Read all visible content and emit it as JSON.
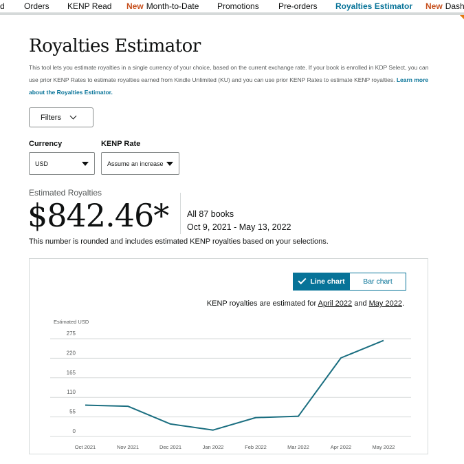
{
  "nav": {
    "items": [
      {
        "label": "d",
        "new": "",
        "x": 0
      },
      {
        "label": "Orders",
        "new": "",
        "x": 35
      },
      {
        "label": "KENP Read",
        "new": "",
        "x": 98
      },
      {
        "label": "Month-to-Date",
        "new": "New",
        "x": 184
      },
      {
        "label": "Promotions",
        "new": "",
        "x": 316
      },
      {
        "label": "Pre-orders",
        "new": "",
        "x": 405
      },
      {
        "label": "Royalties Estimator",
        "new": "",
        "x": 488,
        "active": true
      },
      {
        "label": "Dashb",
        "new": "New",
        "x": 619
      }
    ]
  },
  "page": {
    "title": "Royalties Estimator",
    "description": "This tool lets you estimate royalties in a single currency of your choice, based on the current exchange rate. If your book is enrolled in KDP Select, you can use prior KENP Rates to estimate royalties earned from Kindle Unlimited (KU) and you can use prior KENP Rates to estimate KENP royalties.",
    "learn_more": "Learn more about the Royalties Estimator."
  },
  "filters": {
    "label": "Filters",
    "currency_label": "Currency",
    "currency_value": "USD",
    "kenp_label": "KENP Rate",
    "kenp_value": "Assume an increase"
  },
  "estimate": {
    "label": "Estimated Royalties",
    "amount": "$842.46*",
    "books": "All 87 books",
    "date_range": "Oct 9, 2021 - May 13, 2022",
    "note": "This number is rounded and includes estimated KENP royalties based on your selections."
  },
  "chart_toggle": {
    "line_label": "Line chart",
    "bar_label": "Bar chart",
    "selected": "line"
  },
  "kenp_note": {
    "prefix": "KENP royalties are estimated for ",
    "month1": "April 2022",
    "middle": " and ",
    "month2": "May 2022",
    "suffix": "."
  },
  "colors": {
    "accent": "#077398",
    "line": "#1a6e80",
    "new_badge": "#c7511f"
  },
  "chart_data": {
    "type": "line",
    "ylabel": "Estimated USD",
    "categories": [
      "Oct 2021",
      "Nov 2021",
      "Dec 2021",
      "Jan 2022",
      "Feb 2022",
      "Mar 2022",
      "Apr 2022",
      "May 2022"
    ],
    "values": [
      88,
      85,
      35,
      18,
      53,
      57,
      221,
      270
    ],
    "y_ticks": [
      0,
      55,
      110,
      165,
      220,
      275
    ],
    "ylim": [
      0,
      275
    ],
    "grid": true
  }
}
